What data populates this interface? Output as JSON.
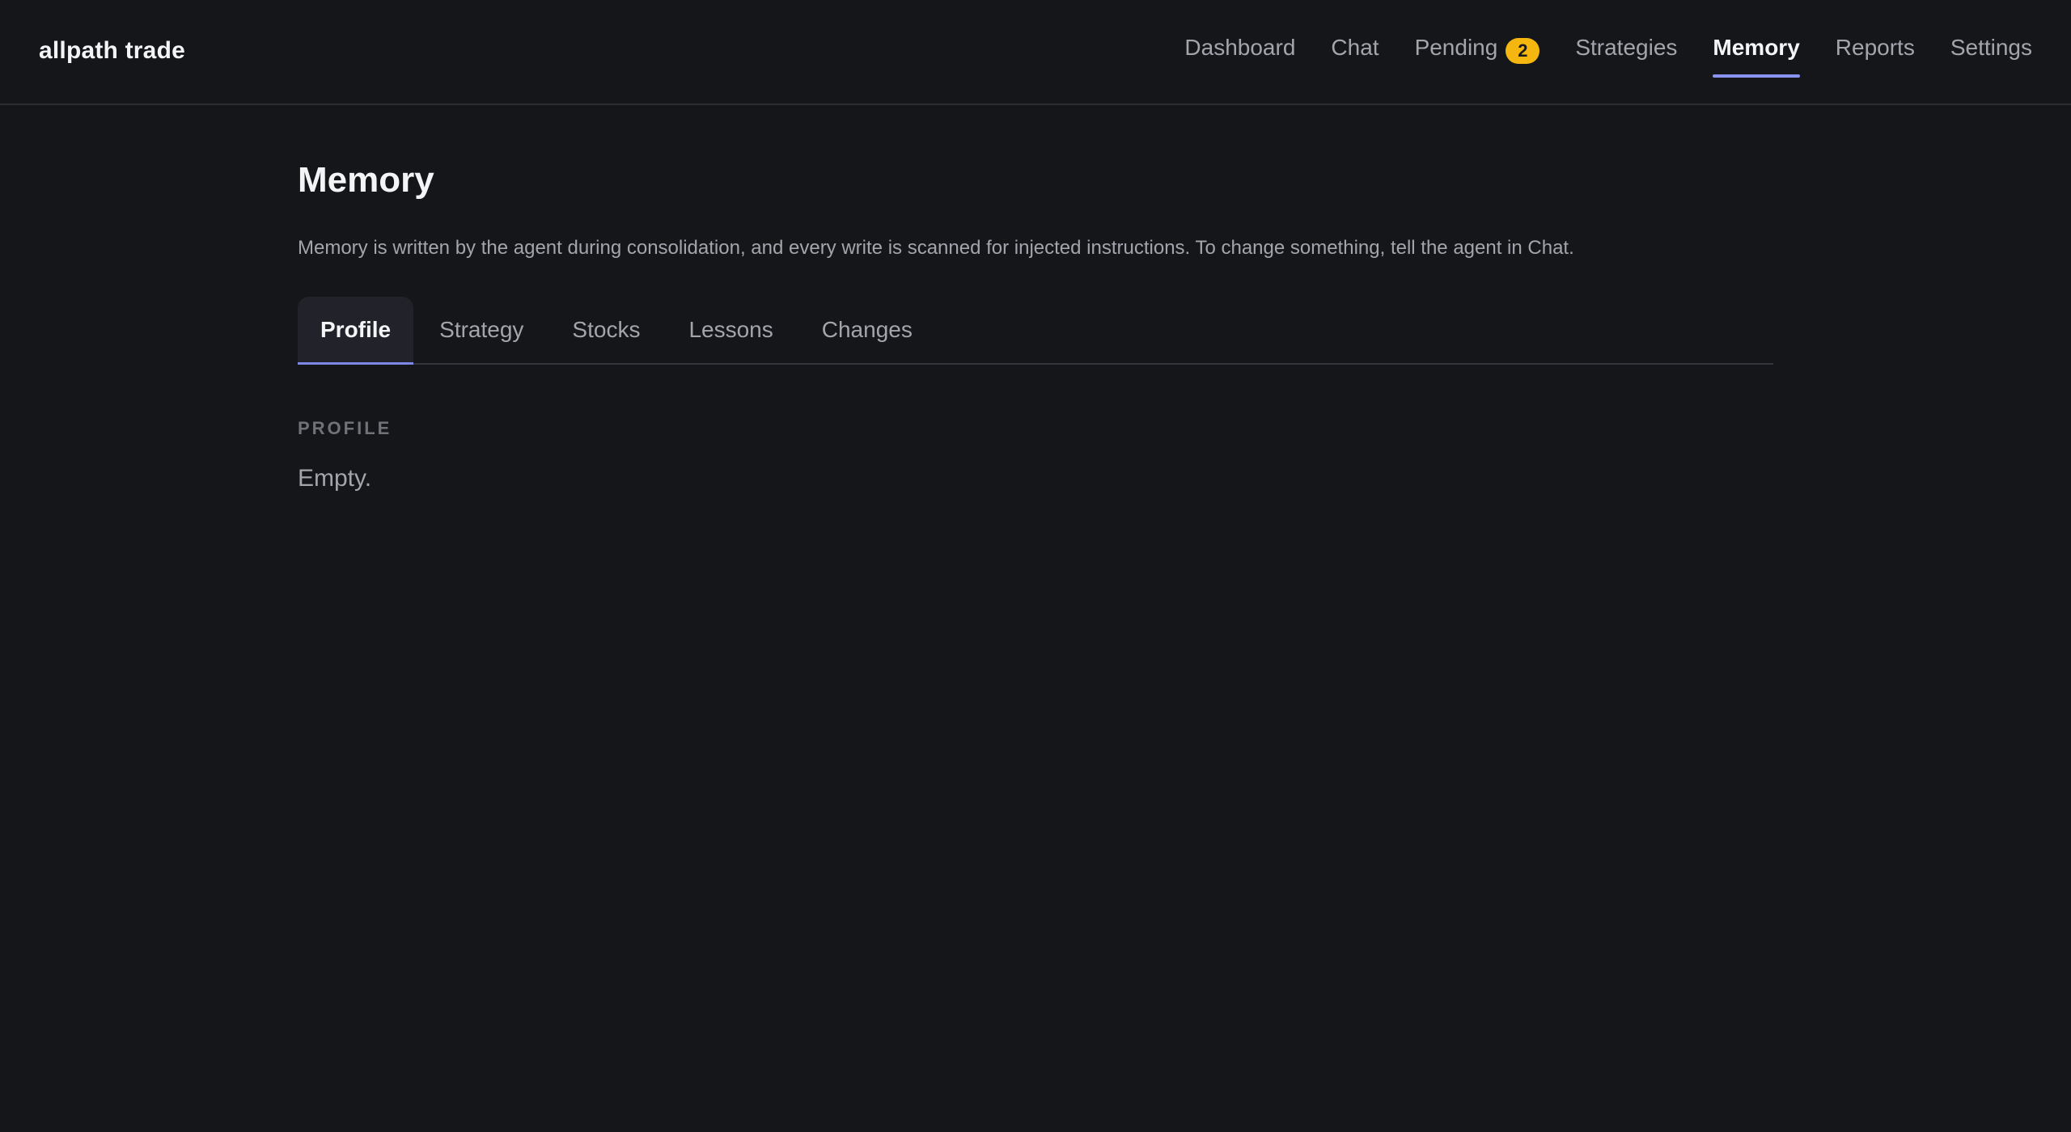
{
  "app": {
    "brand": "allpath trade"
  },
  "nav": {
    "items": [
      {
        "label": "Dashboard"
      },
      {
        "label": "Chat"
      },
      {
        "label": "Pending",
        "badge": "2"
      },
      {
        "label": "Strategies"
      },
      {
        "label": "Memory",
        "active": true
      },
      {
        "label": "Reports"
      },
      {
        "label": "Settings"
      }
    ]
  },
  "page": {
    "title": "Memory",
    "description": "Memory is written by the agent during consolidation, and every write is scanned for injected instructions. To change something, tell the agent in Chat."
  },
  "tabs": [
    {
      "label": "Profile",
      "active": true
    },
    {
      "label": "Strategy"
    },
    {
      "label": "Stocks"
    },
    {
      "label": "Lessons"
    },
    {
      "label": "Changes"
    }
  ],
  "section": {
    "label": "PROFILE",
    "empty_text": "Empty."
  },
  "colors": {
    "background": "#15161a",
    "accent": "#8b93f0",
    "badge": "#f5b70f"
  }
}
